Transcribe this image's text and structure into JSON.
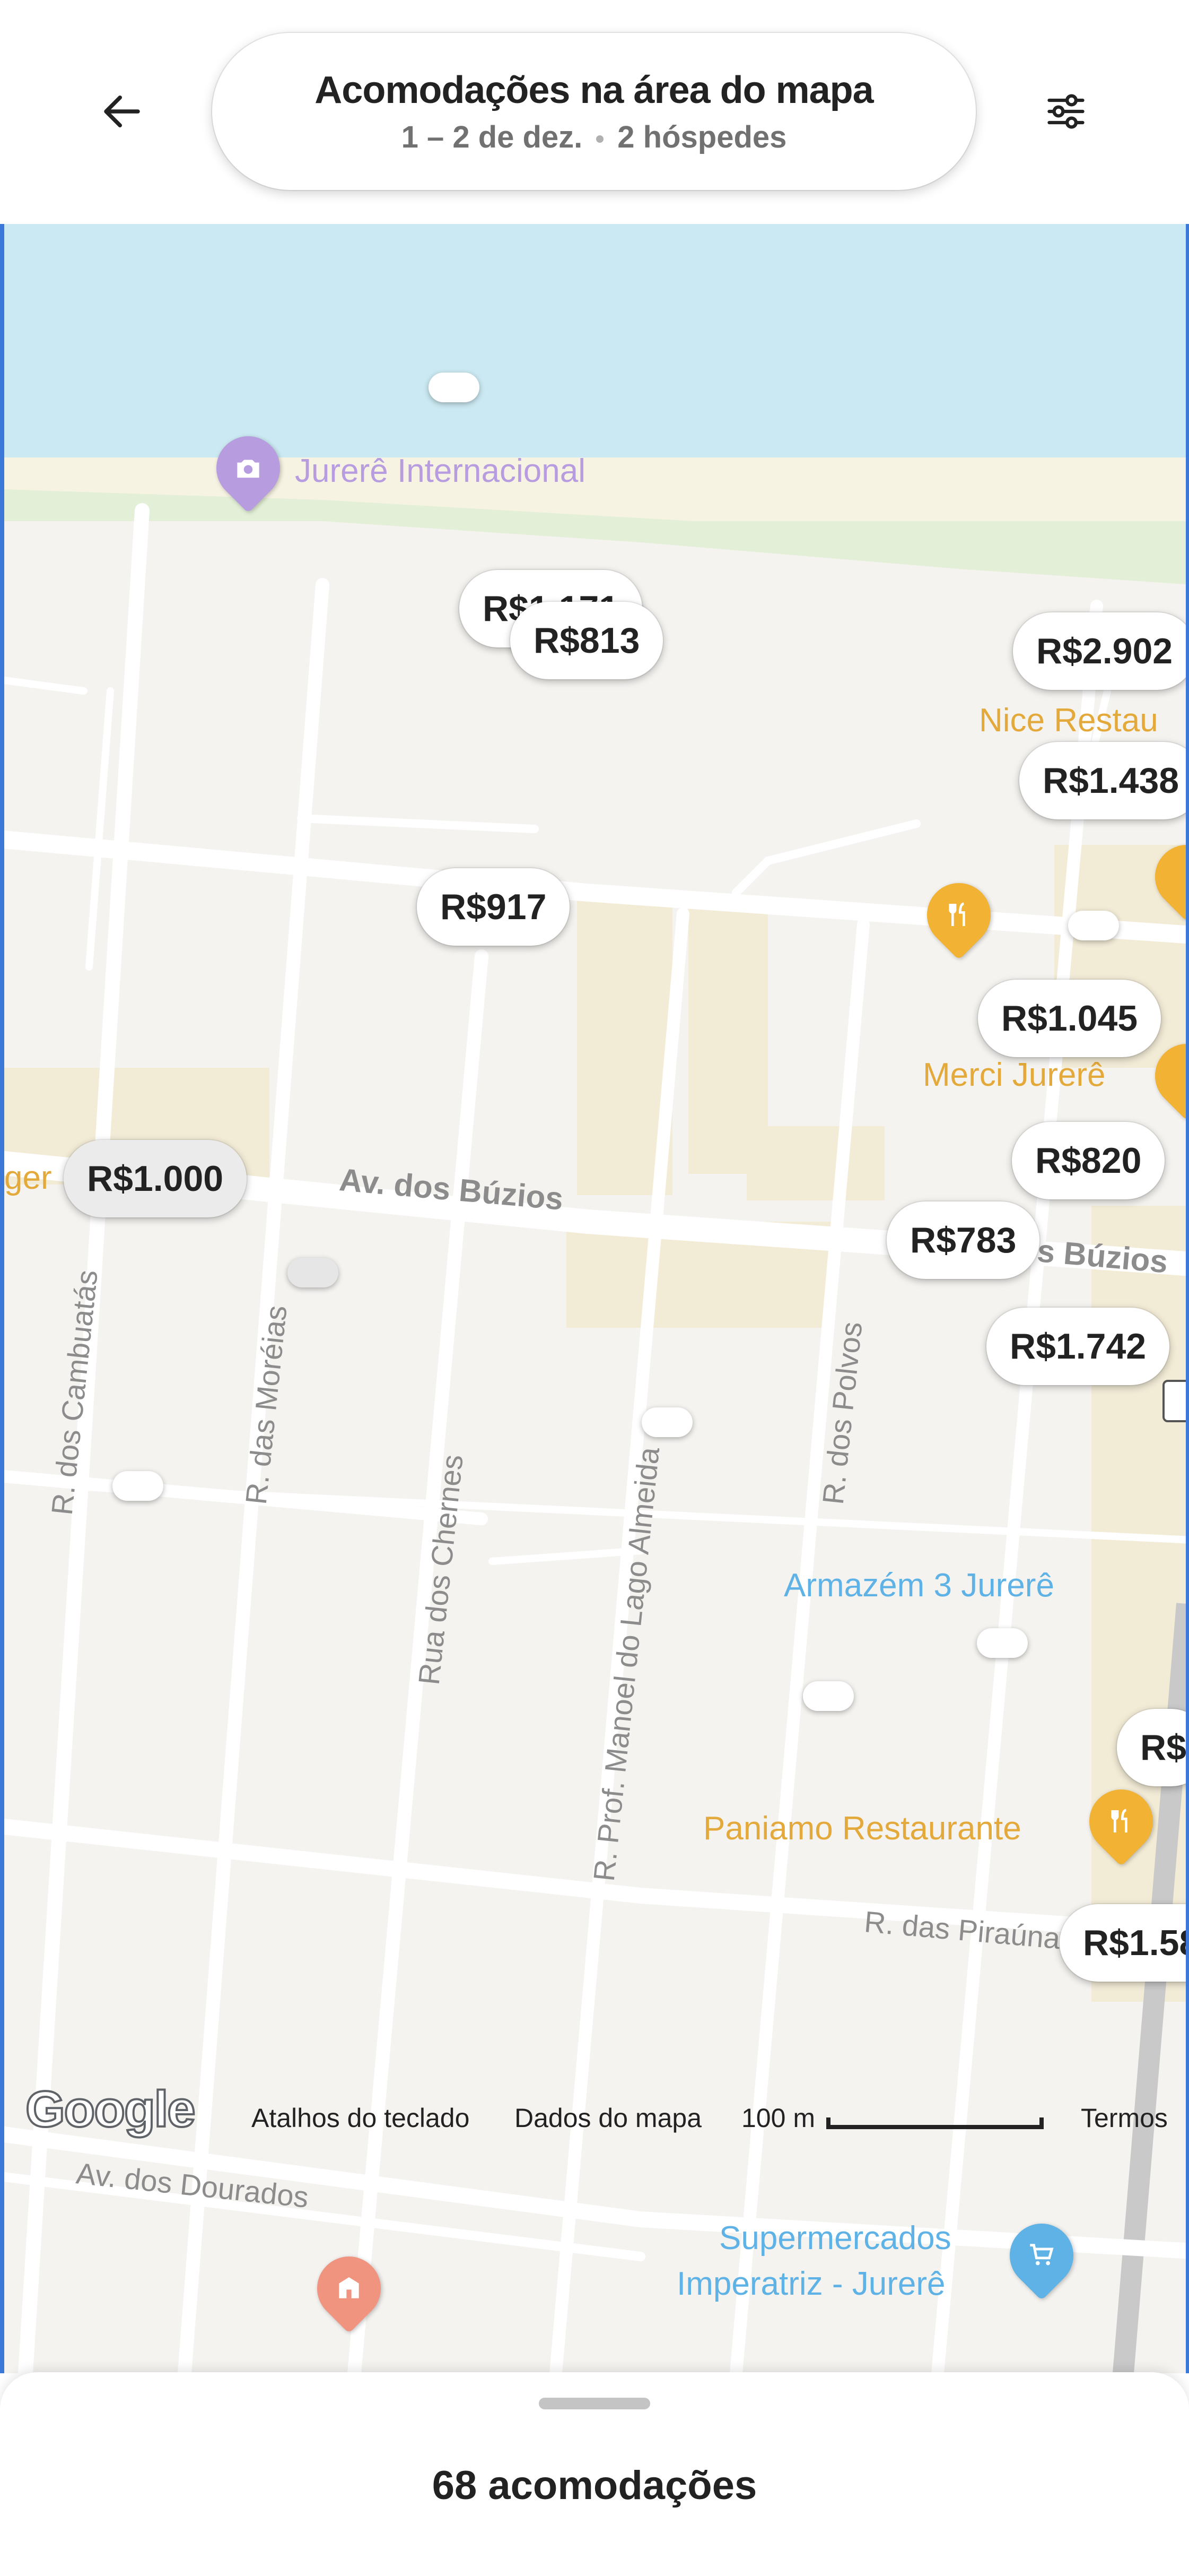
{
  "header": {
    "title": "Acomodações na área do mapa",
    "dates": "1 – 2 de dez.",
    "guests": "2 hóspedes"
  },
  "map": {
    "price_pins": [
      "R$1.171",
      "R$813",
      "R$2.902",
      "R$1.438",
      "R$917",
      "R$1.045",
      "R$1.000",
      "R$820",
      "R$783",
      "R$1.742",
      "R$",
      "R$1.58"
    ],
    "streets": {
      "av_buzios": "Av. dos Búzios",
      "av_buzios_right": "s Búzios",
      "cambuatas": "R. dos Cambuatás",
      "moreias": "R. das Moréias",
      "chernes": "Rua dos Chernes",
      "lago_almeida": "R. Prof. Manoel do Lago Almeida",
      "polvos": "R. dos Polvos",
      "piraunas": "R. das Piraúnas",
      "dourados": "Av. dos Dourados"
    },
    "pois": {
      "jurere": "Jurerê Internacional",
      "nice": "Nice Restau",
      "merci": "Merci Jurerê",
      "armazem": "Armazém 3 Jurerê",
      "paniamo": "Paniamo Restaurante",
      "super_line1": "Supermercados",
      "super_line2": "Imperatriz - Jurerê",
      "left_cut": "ger"
    },
    "attribution": {
      "logo": "Google",
      "shortcuts": "Atalhos do teclado",
      "map_data": "Dados do mapa",
      "scale": "100 m",
      "terms": "Termos"
    },
    "colors": {
      "water": "#cbe9f2",
      "sand": "#f7f3e3",
      "park": "#e3efd6",
      "block": "#f2ebd6",
      "restaurant": "#f2b233",
      "shop": "#5fb2e5",
      "photo": "#b79de0",
      "school": "#f0947f"
    }
  },
  "sheet": {
    "count_label": "68 acomodações"
  }
}
